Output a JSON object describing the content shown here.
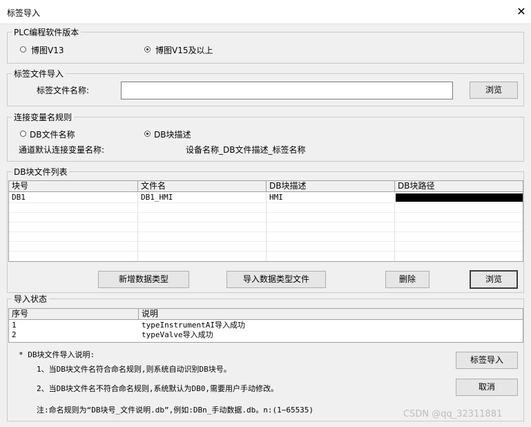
{
  "window": {
    "title": "标签导入",
    "close_glyph": "✕"
  },
  "plc_version": {
    "legend": "PLC编程软件版本",
    "options": [
      {
        "label": "博图V13",
        "selected": false
      },
      {
        "label": "博图V15及以上",
        "selected": true
      }
    ]
  },
  "tag_import": {
    "legend": "标签文件导入",
    "file_label": "标签文件名称:",
    "file_value": "",
    "browse_label": "浏览"
  },
  "naming_rule": {
    "legend": "连接变量名规则",
    "options": [
      {
        "label": "DB文件名称",
        "selected": false
      },
      {
        "label": "DB块描述",
        "selected": true
      }
    ],
    "default_label": "通道默认连接变量名称:",
    "default_value": "设备名称_DB文件描述_标签名称"
  },
  "db_list": {
    "legend": "DB块文件列表",
    "columns": [
      "块号",
      "文件名",
      "DB块描述",
      "DB块路径"
    ],
    "rows": [
      {
        "block": "DB1",
        "file": "DB1_HMI",
        "desc": "HMI",
        "path": "(redacted)"
      }
    ],
    "buttons": {
      "add_type": "新增数据类型",
      "import_type": "导入数据类型文件",
      "delete": "删除",
      "browse": "浏览"
    }
  },
  "import_status": {
    "legend": "导入状态",
    "columns": [
      "序号",
      "说明"
    ],
    "rows": [
      {
        "no": "1",
        "text": "typeInstrumentAI导入成功"
      },
      {
        "no": "2",
        "text": "typeValve导入成功"
      }
    ]
  },
  "notes": {
    "heading": "* DB块文件导入说明:",
    "line1": "1、当DB块文件名符合命名规则,则系统自动识别DB块号。",
    "line2": "2、当DB块文件名不符合命名规则,系统默认为DB0,需要用户手动修改。",
    "line3": "注:命名规则为“DB块号_文件说明.db”,例如:DBn_手动数据.db。n:(1~65535)"
  },
  "actions": {
    "import_label": "标签导入",
    "cancel_label": "取消"
  },
  "watermark": "CSDN @qq_32311881",
  "colors": {
    "background": "#f0f0f0",
    "titlebar": "#ffffff",
    "border": "#c9c9c9",
    "redaction": "#000000"
  }
}
